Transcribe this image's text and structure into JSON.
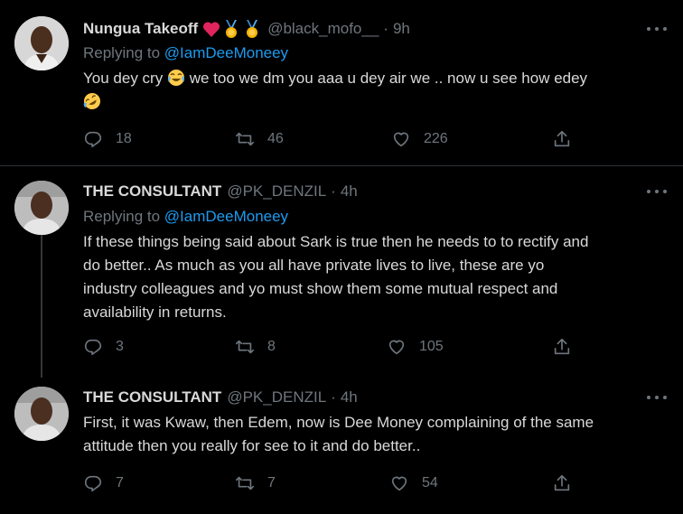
{
  "tweets": [
    {
      "name": "Nungua Takeoff",
      "handle": "@black_mofo__",
      "dot": "·",
      "time": "9h",
      "replying_prefix": "Replying to",
      "replying_to": "@IamDeeMoneey",
      "text_part1": "You dey cry",
      "text_part2": "we too we dm you aaa u dey air we .. now u see how edey",
      "replies": "18",
      "retweets": "46",
      "likes": "226"
    },
    {
      "name": "THE CONSULTANT",
      "handle": "@PK_DENZIL",
      "dot": "·",
      "time": "4h",
      "replying_prefix": "Replying to",
      "replying_to": "@IamDeeMoneey",
      "text_lines": [
        "If these things being said about Sark is true then he needs to to rectify and",
        "do better.. As much as you all have private lives to live, these are yo",
        "industry colleagues and yo must show them some mutual respect and",
        "availability in returns."
      ],
      "replies": "3",
      "retweets": "8",
      "likes": "105"
    },
    {
      "name": "THE CONSULTANT",
      "handle": "@PK_DENZIL",
      "dot": "·",
      "time": "4h",
      "text_lines": [
        "First, it was Kwaw,  then Edem,  now is Dee Money complaining of the same",
        "attitude then you really for see to it and do better.."
      ],
      "replies": "7",
      "retweets": "7",
      "likes": "54"
    }
  ],
  "colors": {
    "background": "#000000",
    "text": "#d9d9d9",
    "muted": "#6e767d",
    "link": "#1d9bf0",
    "heart": "#e0245e",
    "medal": "#f5b400",
    "separator": "#2f3336"
  },
  "icons": [
    "more-icon",
    "reply-icon",
    "retweet-icon",
    "like-icon",
    "share-icon",
    "red-heart-emoji",
    "medal-emoji",
    "joy-emoji",
    "rofl-emoji"
  ]
}
